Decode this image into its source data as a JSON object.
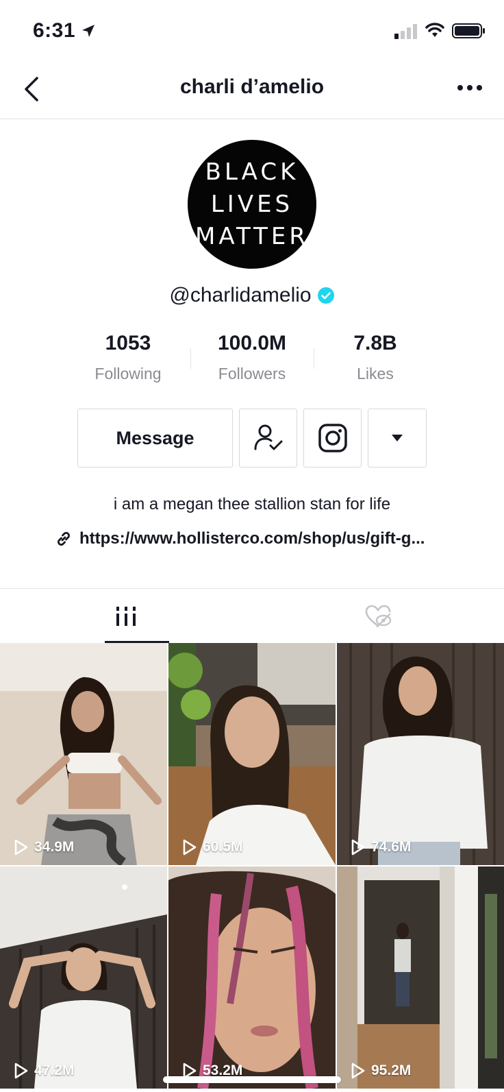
{
  "status_bar": {
    "time": "6:31",
    "icons": [
      "location-arrow-icon",
      "cellular-signal-icon",
      "wifi-icon",
      "battery-icon"
    ]
  },
  "nav": {
    "title": "charli d’amelio",
    "left_icon": "back-chevron-icon",
    "right_icon": "more-dots-icon"
  },
  "profile": {
    "avatar_lines": [
      "BLACK",
      "LIVES",
      "MATTER"
    ],
    "username": "@charlidamelio",
    "verified": true,
    "accent_color": "#20d5ec"
  },
  "stats": [
    {
      "value": "1053",
      "label": "Following"
    },
    {
      "value": "100.0M",
      "label": "Followers"
    },
    {
      "value": "7.8B",
      "label": "Likes"
    }
  ],
  "actions": {
    "message_label": "Message",
    "icons": [
      "following-check-icon",
      "instagram-icon",
      "dropdown-arrow-icon"
    ]
  },
  "bio": {
    "text": "i am a megan thee stallion stan for life",
    "link": "https://www.hollisterco.com/shop/us/gift-g..."
  },
  "tabs": [
    {
      "name": "videos",
      "icon": "videos-grid-icon",
      "active": true
    },
    {
      "name": "liked",
      "icon": "liked-hidden-icon",
      "active": false
    }
  ],
  "videos": [
    {
      "views": "34.9M"
    },
    {
      "views": "60.5M"
    },
    {
      "views": "74.6M"
    },
    {
      "views": "47.2M"
    },
    {
      "views": "53.2M"
    },
    {
      "views": "95.2M"
    }
  ]
}
